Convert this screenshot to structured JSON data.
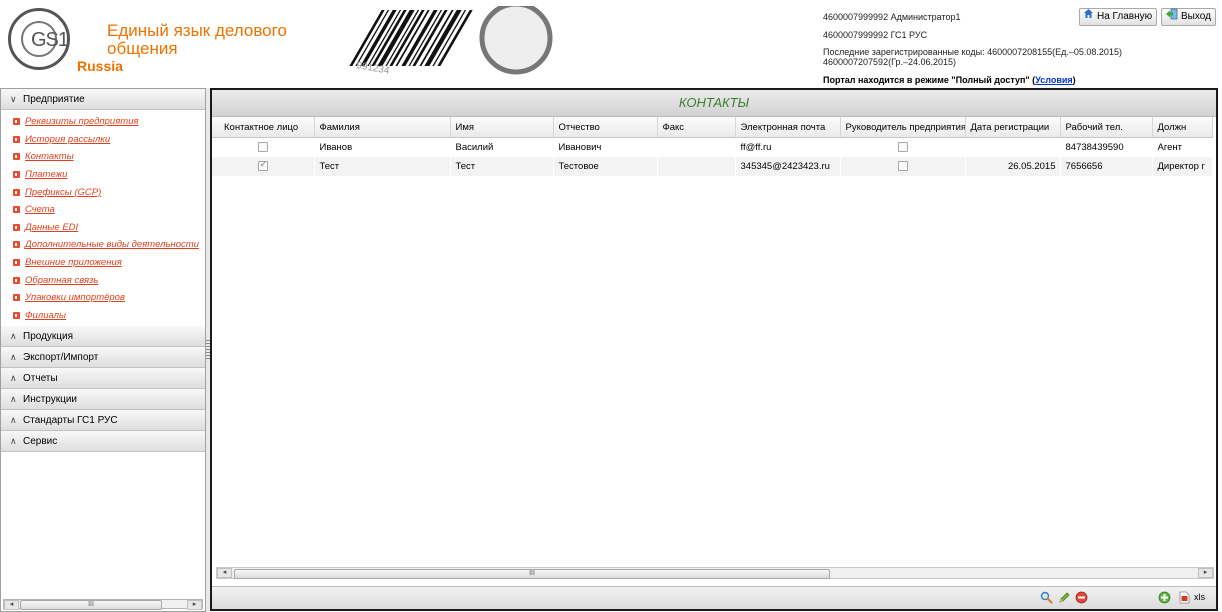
{
  "header": {
    "logo_text": "GS1",
    "logo_country": "Russia",
    "slogan": "Единый язык делового общения",
    "user_line": "4600007999992 Администратор1",
    "company_line": "4600007999992 ГС1 РУС",
    "last_codes_line1": "Последние зарегистрированные коды: 4600007208155(Ед.–05.08.2015)",
    "last_codes_line2": "4600007207592(Гр.–24.06.2015)",
    "portal_mode_prefix": "Портал находится в режиме \"Полный доступ\" (",
    "portal_mode_link": "Условия",
    "portal_mode_suffix": ")",
    "home_button": "На Главную",
    "exit_button": "Выход",
    "barcode_digits": "991234"
  },
  "sidebar": {
    "sections": [
      {
        "label": "Предприятие",
        "expanded": true
      },
      {
        "label": "Продукция",
        "expanded": false
      },
      {
        "label": "Экспорт/Импорт",
        "expanded": false
      },
      {
        "label": "Отчеты",
        "expanded": false
      },
      {
        "label": "Инструкции",
        "expanded": false
      },
      {
        "label": "Стандарты ГС1 РУС",
        "expanded": false
      },
      {
        "label": "Сервис",
        "expanded": false
      }
    ],
    "items": [
      "Реквизиты предприятия",
      "История рассылки",
      "Контакты",
      "Платежи",
      "Префиксы (GCP)",
      "Счета",
      "Данные EDI",
      "Дополнительные виды деятельности",
      "Внешние приложения",
      "Обратная связь",
      "Упаковки импортёров",
      "Филиалы"
    ],
    "scroll_glyph": "III"
  },
  "grid": {
    "title": "КОНТАКТЫ",
    "columns": [
      "Контактное лицо",
      "Фамилия",
      "Имя",
      "Отчество",
      "Факс",
      "Электронная почта",
      "Руководитель предприятия",
      "Дата регистрации",
      "Рабочий тел.",
      "Должн"
    ],
    "rows": [
      {
        "contact": false,
        "last": "Иванов",
        "first": "Василий",
        "middle": "Иванович",
        "fax": "",
        "email": "ff@ff.ru",
        "head": false,
        "reg_date": "",
        "phone": "84738439590",
        "position": "Агент"
      },
      {
        "contact": true,
        "last": "Тест",
        "first": "Тест",
        "middle": "Тестовое",
        "fax": "",
        "email": "345345@2423423.ru",
        "head": false,
        "reg_date": "26.05.2015",
        "phone": "7656656",
        "position": "Директор г"
      }
    ],
    "scroll_glyph": "III",
    "export_label": "xls"
  },
  "colors": {
    "accent_orange": "#ef7200",
    "link_red": "#e0401f",
    "title_green": "#3a7d2f"
  }
}
